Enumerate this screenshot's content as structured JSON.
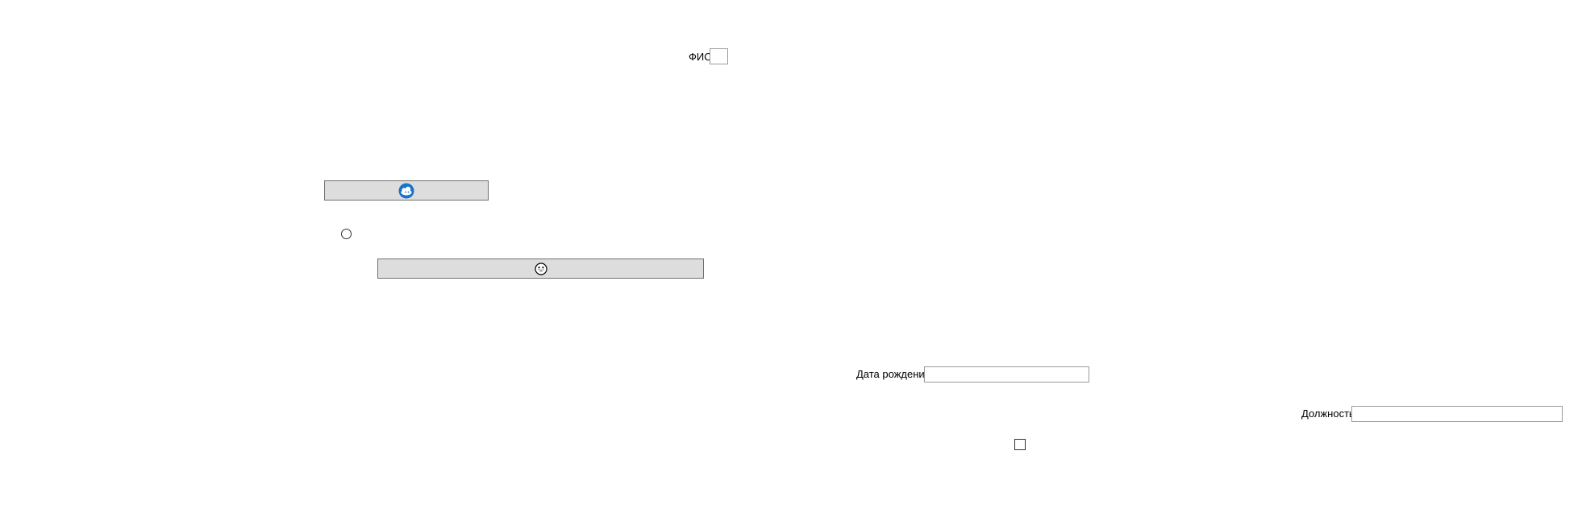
{
  "form": {
    "fio_label": "ФИО",
    "fio_value": "",
    "birthdate_label": "Дата рождения",
    "birthdate_value": "",
    "position_label": "Должность",
    "position_value": ""
  },
  "buttons": {
    "primary_icon": "cloud-avatar-icon",
    "secondary_icon": "smiley-icon"
  },
  "colors": {
    "button_bg": "#dddddd",
    "button_border": "#707070",
    "icon_blue": "#1a73c8"
  }
}
